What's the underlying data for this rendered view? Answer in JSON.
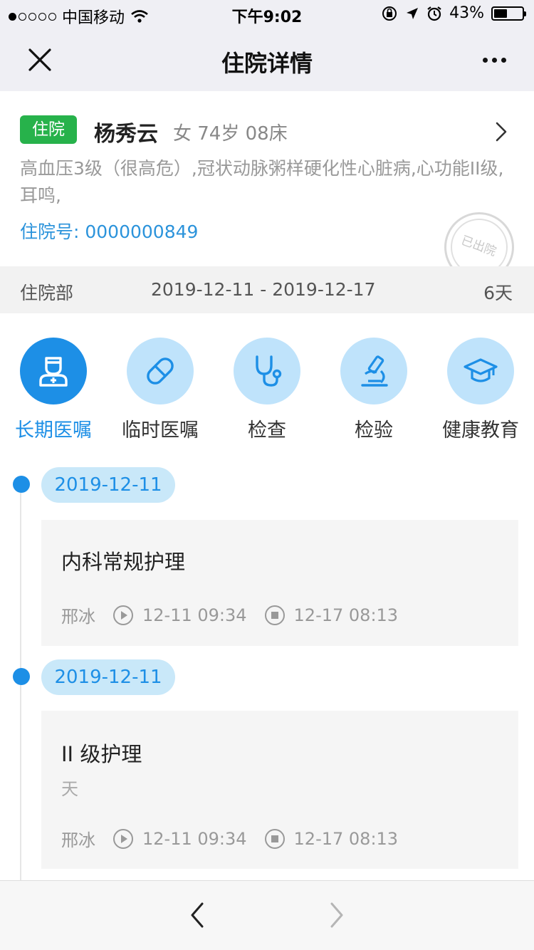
{
  "status_bar": {
    "carrier": "中国移动",
    "time": "下午9:02",
    "battery": "43%"
  },
  "nav": {
    "title": "住院详情"
  },
  "patient": {
    "tag": "住院",
    "name": "杨秀云",
    "info": "女 74岁 08床",
    "diagnosis": "高血压3级（很高危）,冠状动脉粥样硬化性心脏病,心功能II级,耳鸣,",
    "hospital_no": "住院号: 0000000849",
    "stamp": "已出院"
  },
  "dept": {
    "name": "住院部",
    "dates": "2019-12-11 - 2019-12-17",
    "days": "6天"
  },
  "tabs": [
    {
      "label": "长期医嘱",
      "icon": "doctor-icon",
      "active": true
    },
    {
      "label": "临时医嘱",
      "icon": "pill-icon",
      "active": false
    },
    {
      "label": "检查",
      "icon": "stethoscope-icon",
      "active": false
    },
    {
      "label": "检验",
      "icon": "microscope-icon",
      "active": false
    },
    {
      "label": "健康教育",
      "icon": "graduation-cap-icon",
      "active": false
    }
  ],
  "orders": [
    {
      "date": "2019-12-11",
      "title": "内科常规护理",
      "subtitle": "",
      "doctor": "邢冰",
      "start": "12-11 09:34",
      "end": "12-17 08:13"
    },
    {
      "date": "2019-12-11",
      "title": "II 级护理",
      "subtitle": "天",
      "doctor": "邢冰",
      "start": "12-11 09:34",
      "end": "12-17 08:13"
    }
  ],
  "colors": {
    "accent": "#1d8fe6",
    "tag_green": "#27b24b",
    "light_blue": "#bfe3fb"
  }
}
